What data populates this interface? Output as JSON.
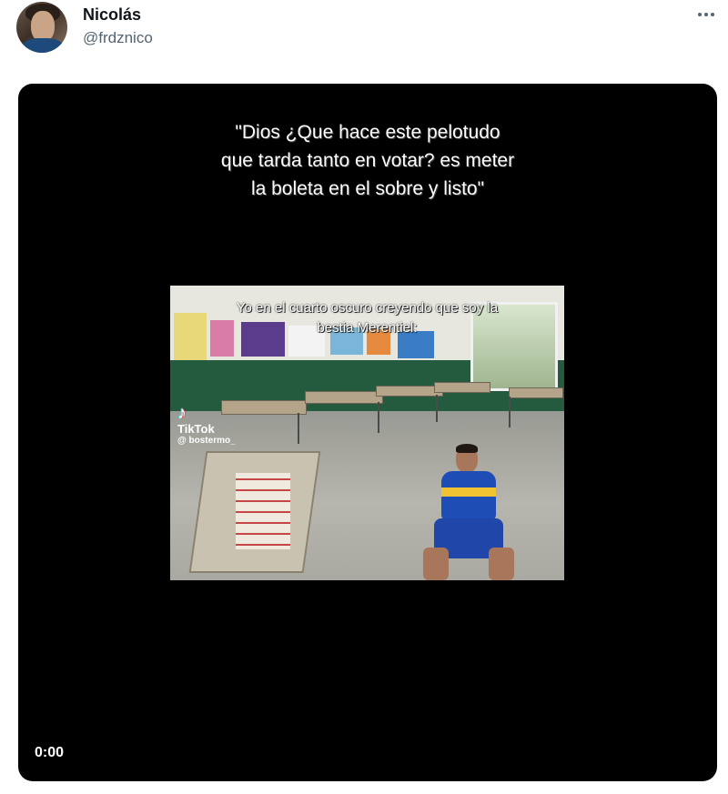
{
  "tweet": {
    "display_name": "Nicolás",
    "handle": "@frdznico"
  },
  "media": {
    "caption_lines": [
      "\"Dios ¿Que hace este pelotudo",
      "que tarda tanto en votar? es meter",
      "la boleta en el sobre y listo\""
    ],
    "frame_caption_lines": [
      "Yo en el cuarto oscuro creyendo que soy la",
      "bestia Merentiel:"
    ],
    "watermark": {
      "brand": "TikTok",
      "user": "@ bostermo_"
    },
    "time": "0:00"
  },
  "icons": {
    "more": "more-horizontal-icon",
    "tiktok": "tiktok-logo-icon"
  },
  "colors": {
    "handle": "#536471",
    "video_background": "#000000"
  }
}
